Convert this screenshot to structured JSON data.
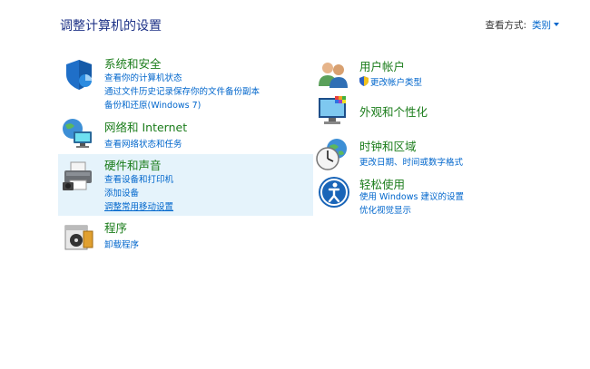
{
  "page": {
    "title": "调整计算机的设置"
  },
  "view_by": {
    "label": "查看方式:",
    "value": "类别"
  },
  "left": [
    {
      "title": "系统和安全",
      "links": [
        "查看你的计算机状态",
        "通过文件历史记录保存你的文件备份副本",
        "备份和还原(Windows 7)"
      ],
      "icon": "shield-icon"
    },
    {
      "title": "网络和 Internet",
      "links": [
        "查看网络状态和任务"
      ],
      "icon": "network-icon"
    },
    {
      "title": "硬件和声音",
      "links": [
        "查看设备和打印机",
        "添加设备",
        "调整常用移动设置"
      ],
      "icon": "printer-icon"
    },
    {
      "title": "程序",
      "links": [
        "卸载程序"
      ],
      "icon": "programs-icon"
    }
  ],
  "right": [
    {
      "title": "用户帐户",
      "links": [
        "更改帐户类型"
      ],
      "icon": "users-icon"
    },
    {
      "title": "外观和个性化",
      "links": [],
      "icon": "monitor-icon"
    },
    {
      "title": "时钟和区域",
      "links": [
        "更改日期、时间或数字格式"
      ],
      "icon": "clock-globe-icon"
    },
    {
      "title": "轻松使用",
      "links": [
        "使用 Windows 建议的设置",
        "优化视觉显示"
      ],
      "icon": "ease-of-access-icon"
    }
  ]
}
